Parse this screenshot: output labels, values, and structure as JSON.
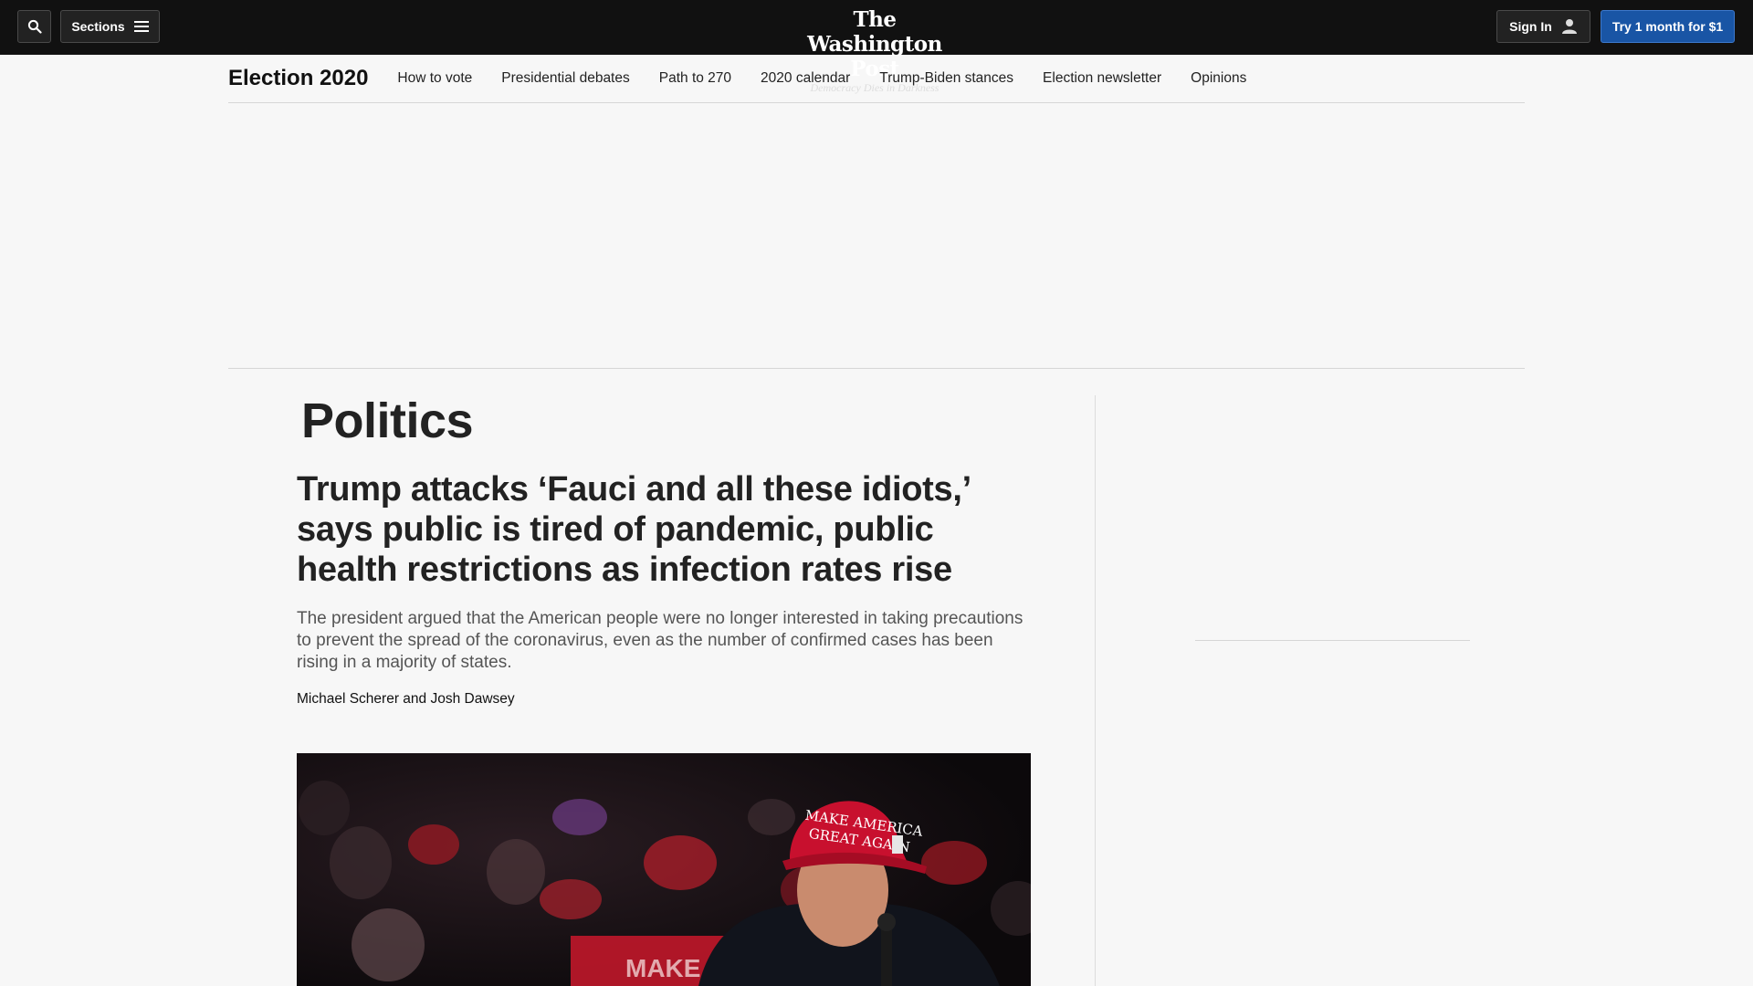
{
  "topbar": {
    "sections_label": "Sections",
    "masthead": "The Washington Post",
    "tagline": "Democracy Dies in Darkness",
    "signin_label": "Sign In",
    "subscribe_label": "Try 1 month for $1"
  },
  "subnav": {
    "title": "Election 2020",
    "links": [
      "How to vote",
      "Presidential debates",
      "Path to 270",
      "2020 calendar",
      "Trump-Biden stances",
      "Election newsletter",
      "Opinions"
    ]
  },
  "article": {
    "section": "Politics",
    "headline": "Trump attacks ‘Fauci and all these idiots,’ says public is tired of pandemic, public health restrictions as infection rates rise",
    "dek": "The president argued that the American people were no longer interested in taking precautions to prevent the spread of the coronavirus, even as the number of confirmed cases has been rising in a majority of states.",
    "authors": [
      "Michael Scherer",
      "Josh Dawsey"
    ],
    "author_joiner": " and ",
    "photo": {
      "hat_text_line1": "MAKE AMERICA",
      "hat_text_line2": "GREAT AGAIN",
      "sign_text": "MAKE"
    }
  },
  "colors": {
    "topbar_bg": "#111111",
    "subscribe_bg": "#1955a5",
    "page_bg": "#f7f7f7",
    "hat_red": "#c8102e"
  }
}
